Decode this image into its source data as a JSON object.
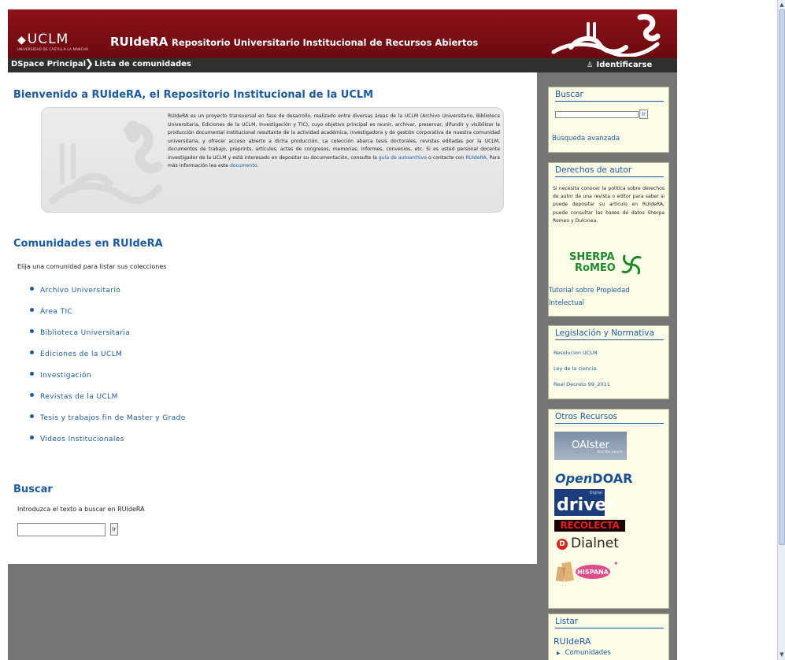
{
  "header": {
    "logo": "UCLM",
    "logo_sub": "UNIVERSIDAD DE CASTILLA-LA MANCHA",
    "site_name": "RUIdeRA",
    "tagline": "Repositorio Universitario Institucional de Recursos Abiertos"
  },
  "breadcrumb": {
    "home": "DSpace Principal",
    "separator": "❯",
    "current": "Lista de comunidades",
    "login": "Identificarse"
  },
  "main": {
    "welcome_title": "Bienvenido a RUIdeRA, el Repositorio Institucional de la UCLM",
    "intro_text_before_link1": "RUIdeRA es un proyecto transversal en fase de desarrollo, realizado entre diversas áreas de la UCLM (Archivo Universitario, Biblioteca Universitaria, Ediciones de la UCLM, Investigación y TIC), cuyo objetivo principal es reunir, archivar, preservar, difundir y visibilizar la producción documental institucional resultante de la actividad académica, investigadora y de gestión corporativa de nuestra comunidad universitaria, y ofrecer acceso abierto a dicha producción. La colección abarca tesis doctorales, revistas editadas por la UCLM, documentos de trabajo, preprints, artículos, actas de congresos, memorias, informes, convenios, etc. Si es usted personal docente investigador de la UCLM y está interesado en depositar su documentación, consulte la",
    "intro_link1": "guía de autoarchivo",
    "intro_text_mid": "o contacte con",
    "intro_link2": "RUIdeRA",
    "intro_text_after": ". Para más información lea este",
    "intro_link3": "documento",
    "intro_end": ".",
    "communities_title": "Comunidades en RUIdeRA",
    "communities_hint": "Elija una comunidad para listar sus colecciones",
    "communities": [
      "Archivo Universitario",
      "Área TIC",
      "Biblioteca Universitaria",
      "Ediciones de la UCLM",
      "Investigación",
      "Revistas de la UCLM",
      "Tesis y trabajos fin de Master y Grado",
      "Videos Institucionales"
    ],
    "search_title": "Buscar",
    "search_hint": "Introduzca el texto a buscar en RUIdeRA",
    "search_value": "",
    "search_button": "Ir"
  },
  "sidebar": {
    "search": {
      "title": "Buscar",
      "value": "",
      "button": "Ir",
      "advanced": "Búsqueda avanzada"
    },
    "rights": {
      "title": "Derechos de autor",
      "text": "Si necesita conocer la política sobre derechos de autor de una revista o editor para saber si puede depositar su artículo en RUIdeRA, puede consultar las bases de datos Sherpa Romeo y Dulcinea.",
      "sherpa": "SHERPA",
      "romeo": "RoMEO",
      "tutorial": "Tutorial sobre Propiedad Intelectual"
    },
    "legal": {
      "title": "Legislación y Normativa",
      "links": [
        "Resolucion UCLM",
        "Ley de la ciencia",
        "Real Decreto 99_2011"
      ]
    },
    "resources": {
      "title": "Otros Recursos",
      "oaister": "OAIster",
      "oaister_tag": "find the pearls",
      "opendoar_open": "Open",
      "opendoar_doar": "DOAR",
      "driver": "driver",
      "driver_digital": "Digital",
      "recolecta": "RECOLECTA",
      "dialnet": "Dialnet",
      "hispana": "HISPANA"
    },
    "browse": {
      "title": "Listar",
      "root": "RUIdeRA",
      "communities": "Comunidades"
    }
  },
  "colors": {
    "header_red": "#7a0e14",
    "link_blue": "#1a5aa3",
    "sidebar_bg": "#fdfde7",
    "frame_gray": "#757575"
  }
}
